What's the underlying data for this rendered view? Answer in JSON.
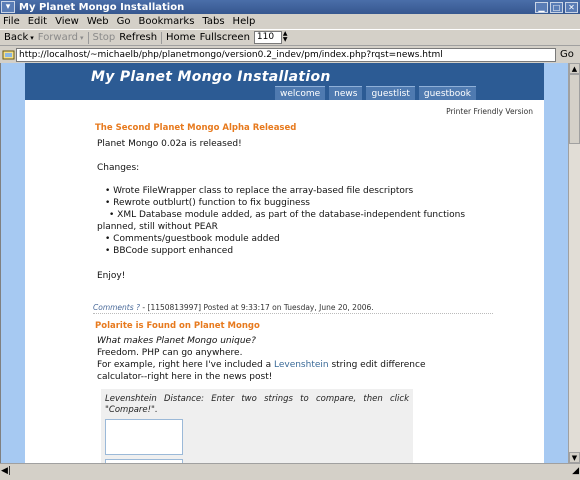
{
  "window": {
    "title": "My Planet Mongo Installation"
  },
  "menu": [
    "File",
    "Edit",
    "View",
    "Web",
    "Go",
    "Bookmarks",
    "Tabs",
    "Help"
  ],
  "toolbar": {
    "back": "Back",
    "forward": "Forward",
    "stop": "Stop",
    "refresh": "Refresh",
    "home": "Home",
    "fullscreen": "Fullscreen",
    "zoom": "110"
  },
  "address": {
    "url": "http://localhost/~michaelb/php/planetmongo/version0.2_indev/pm/index.php?rqst=news.html",
    "go": "Go"
  },
  "site": {
    "title": "My Planet Mongo Installation",
    "tabs": [
      "welcome",
      "news",
      "guestlist",
      "guestbook"
    ],
    "print_link": "Printer Friendly Version",
    "article1": {
      "title": "The Second Planet Mongo Alpha Released",
      "intro": "Planet Mongo 0.02a is released!",
      "changes_label": "Changes:",
      "bullets": [
        "• Wrote FileWrapper class to replace the array-based file descriptors",
        "• Rewrote outblurt() function to fix bugginess",
        "• XML Database module added, as part of the database-independent functions",
        "planned, still without PEAR",
        "• Comments/guestbook module added",
        "• BBCode support enhanced"
      ],
      "outro": "Enjoy!",
      "comments": "Comments ?",
      "meta": "- [1150813997] Posted at 9:33:17 on Tuesday, June 20, 2006."
    },
    "article2": {
      "title": "Polarite is Found on Planet Mongo",
      "q": "What makes Planet Mongo unique?",
      "a1": "Freedom. PHP can go anywhere.",
      "a2_pre": "For example, right here I've included a",
      "a2_link": "Levenshtein",
      "a2_post": "string edit difference",
      "a3": "calculator--right here in the news post!",
      "lev_label": "Levenshtein Distance: Enter two strings to compare, then click \"Compare!\"."
    }
  }
}
